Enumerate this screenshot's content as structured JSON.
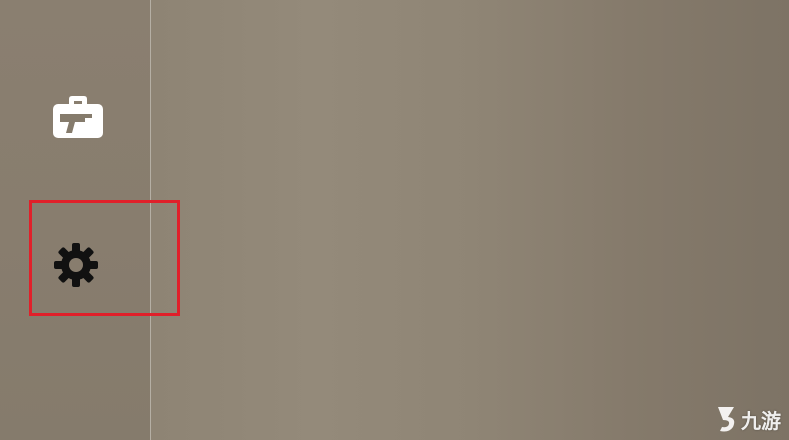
{
  "sidebar": {
    "items": [
      {
        "id": "loadout",
        "icon": "briefcase-gun-icon",
        "color": "#ffffff"
      },
      {
        "id": "settings",
        "icon": "gear-icon",
        "color": "#111111"
      }
    ]
  },
  "highlight": {
    "target": "settings",
    "color": "#e0202a"
  },
  "watermark": {
    "text": "九游"
  }
}
